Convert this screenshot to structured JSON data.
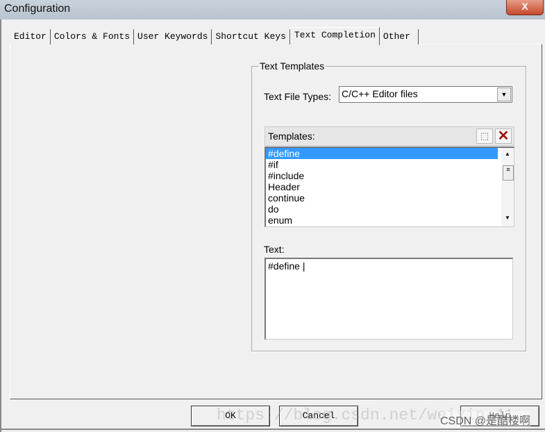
{
  "window": {
    "title": "Configuration",
    "close_label": "X"
  },
  "tabs": [
    {
      "label": "Editor"
    },
    {
      "label": "Colors & Fonts"
    },
    {
      "label": "User Keywords"
    },
    {
      "label": "Shortcut Keys"
    },
    {
      "label": "Text Completion",
      "active": true
    },
    {
      "label": "Other"
    }
  ],
  "group": {
    "title": "Text Templates",
    "file_types_label": "Text File Types:",
    "file_types_value": "C/C++ Editor files",
    "templates_label": "Templates:",
    "templates": [
      "#define",
      "#if",
      "#include",
      "Header",
      "continue",
      "do",
      "enum"
    ],
    "selected": "#define",
    "text_label": "Text:",
    "text_value": "#define |"
  },
  "icons": {
    "new": "new-template-icon",
    "delete": "delete-icon",
    "delete_color": "#a01010",
    "selection_color": "#3399ff"
  },
  "buttons": {
    "ok": "OK",
    "cancel": "Cancel",
    "help": "Help"
  },
  "watermark": {
    "url": "https://blog.csdn.net/weixin_41",
    "credit": "CSDN @是酷楼啊"
  }
}
